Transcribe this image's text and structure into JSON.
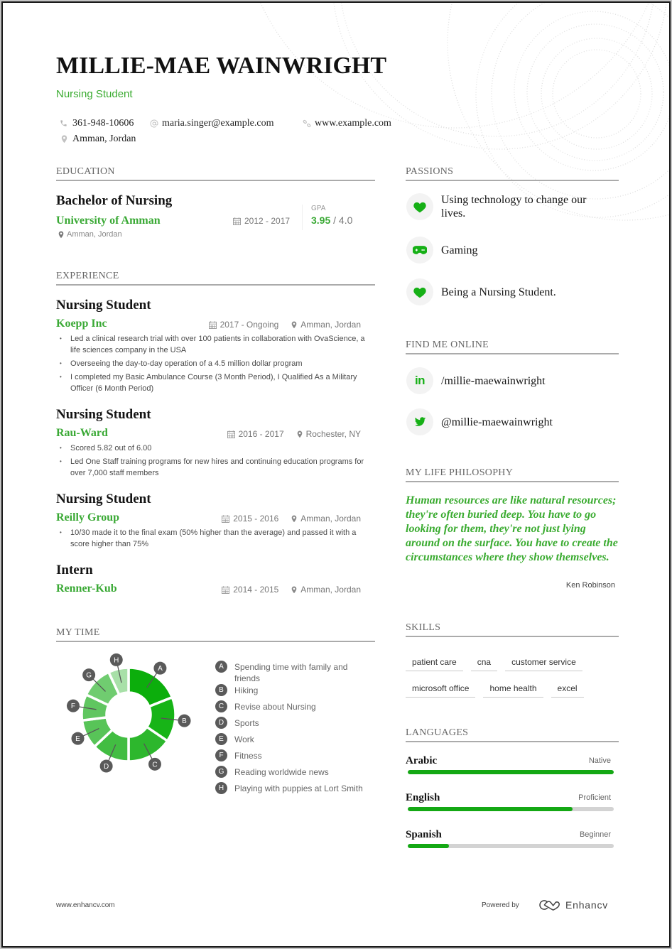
{
  "header": {
    "name": "MILLIE-MAE WAINWRIGHT",
    "title": "Nursing Student",
    "phone": "361-948-10606",
    "email": "maria.singer@example.com",
    "website": "www.example.com",
    "location": "Amman, Jordan",
    "icons": {
      "phone": "phone-icon",
      "email": "at-icon",
      "website": "link-icon",
      "location": "map-pin-icon"
    }
  },
  "colors": {
    "accent_text": "#3aab30",
    "accent_icon": "#16b016",
    "bar_fill": "#14a814",
    "bar_track": "#d3d3d3",
    "section_rule": "#ababab",
    "label_bubble": "#5a5a5a"
  },
  "education": {
    "heading": "EDUCATION",
    "items": [
      {
        "degree": "Bachelor of Nursing",
        "school": "University of Amman",
        "dates": "2012 - 2017",
        "location": "Amman, Jordan",
        "gpa_label": "GPA",
        "gpa": "3.95",
        "gpa_separator": "/",
        "gpa_max": "4.0"
      }
    ]
  },
  "experience": {
    "heading": "EXPERIENCE",
    "items": [
      {
        "title": "Nursing Student",
        "company": "Koepp Inc",
        "dates": "2017 - Ongoing",
        "location": "Amman, Jordan",
        "bullets": [
          "Led a clinical research trial with over 100 patients in collaboration with OvaScience, a life sciences company in the USA",
          "Overseeing the day-to-day operation of a 4.5 million dollar program",
          "I completed my Basic Ambulance Course (3 Month Period), I Qualified As a Military Officer (6 Month Period)"
        ]
      },
      {
        "title": "Nursing Student",
        "company": "Rau-Ward",
        "dates": "2016 - 2017",
        "location": "Rochester, NY",
        "bullets": [
          "Scored 5.82 out of 6.00",
          "Led One Staff training programs for new  hires and continuing education programs for over 7,000 staff members"
        ]
      },
      {
        "title": "Nursing Student",
        "company": "Reilly Group",
        "dates": "2015 - 2016",
        "location": "Amman, Jordan",
        "bullets": [
          "10/30 made it to the final exam (50% higher than the average) and passed it with a score higher than 75%"
        ]
      },
      {
        "title": "Intern",
        "company": "Renner-Kub",
        "dates": "2014 - 2015",
        "location": "Amman, Jordan",
        "bullets": []
      }
    ]
  },
  "my_time": {
    "heading": "MY TIME"
  },
  "chart_data": {
    "type": "pie",
    "donut": true,
    "title": "MY TIME",
    "categories": [
      "A",
      "B",
      "C",
      "D",
      "E",
      "F",
      "G",
      "H"
    ],
    "labels": [
      "Spending time with family and friends",
      "Hiking",
      "Revise about Nursing",
      "Sports",
      "Work",
      "Fitness",
      "Reading worldwide news",
      "Playing with puppies at Lort Smith"
    ],
    "values": [
      19,
      15.5,
      15.5,
      13,
      10,
      9,
      11,
      7
    ],
    "value_unit": "percent of time (estimated from slice angles)",
    "colors": [
      "#0cae0c",
      "#17b417",
      "#2db72d",
      "#42bd42",
      "#58c458",
      "#60c660",
      "#70cc70",
      "#a8e0a8"
    ],
    "legend_position": "right"
  },
  "passions": {
    "heading": "PASSIONS",
    "items": [
      {
        "icon": "heart-icon",
        "text": "Using technology to change our lives."
      },
      {
        "icon": "gamepad-icon",
        "text": "Gaming"
      },
      {
        "icon": "heart-icon",
        "text": "Being a Nursing Student."
      }
    ]
  },
  "find_me_online": {
    "heading": "FIND ME ONLINE",
    "items": [
      {
        "icon": "linkedin-icon",
        "glyph": "in",
        "handle": "/millie-maewainwright"
      },
      {
        "icon": "twitter-icon",
        "handle": "@millie-maewainwright"
      }
    ]
  },
  "life_philosophy": {
    "heading": "MY LIFE PHILOSOPHY",
    "quote": "Human resources are like natural resources; they're often buried deep. You have to go looking for them, they're not just lying around on the surface. You have to create the circumstances where they show themselves.",
    "author": "Ken Robinson"
  },
  "skills": {
    "heading": "SKILLS",
    "items": [
      "patient care",
      "cna",
      "customer service",
      "microsoft office",
      "home health",
      "excel"
    ]
  },
  "languages": {
    "heading": "LANGUAGES",
    "items": [
      {
        "name": "Arabic",
        "level": "Native",
        "proficiency": 1.0
      },
      {
        "name": "English",
        "level": "Proficient",
        "proficiency": 0.8
      },
      {
        "name": "Spanish",
        "level": "Beginner",
        "proficiency": 0.2
      }
    ]
  },
  "footer": {
    "website": "www.enhancv.com",
    "powered_by": "Powered by",
    "brand": "Enhancv"
  }
}
